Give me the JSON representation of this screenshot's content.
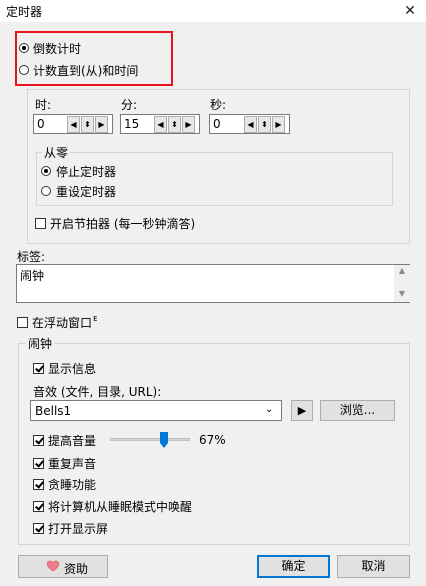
{
  "window": {
    "title": "定时器",
    "close_glyph": "✕"
  },
  "mode": {
    "countdown_label": "倒数计时",
    "countup_label": "计数直到(从)和时间",
    "selected": "countdown"
  },
  "time": {
    "hours_label": "时:",
    "minutes_label": "分:",
    "seconds_label": "秒:",
    "hours_value": "0",
    "minutes_value": "15",
    "seconds_value": "0"
  },
  "from_zero": {
    "group_label": "从零",
    "stop_label": "停止定时器",
    "reset_label": "重设定时器",
    "selected": "stop"
  },
  "metronome": {
    "label": "开启节拍器 (每一秒钟滴答)",
    "checked": false
  },
  "tag": {
    "label": "标签:",
    "value": "闹钟"
  },
  "float_window": {
    "label": "在浮动窗口",
    "cursor": "ᴇ",
    "checked": false
  },
  "alarm": {
    "group_label": "闹钟",
    "show_message_label": "显示信息",
    "sound_label": "音效 (文件, 目录, URL):",
    "sound_value": "Bells1",
    "browse_label": "浏览...",
    "play_glyph": "▶",
    "raise_volume_label": "提高音量",
    "volume_percent": "67%",
    "volume_value": 0.67,
    "repeat_sound_label": "重复声音",
    "snooze_label": "贪睡功能",
    "wake_label": "将计算机从睡眠模式中唤醒",
    "turn_on_display_label": "打开显示屏",
    "checked": {
      "show_message": true,
      "raise_volume": true,
      "repeat_sound": true,
      "snooze": true,
      "wake": true,
      "display": true
    }
  },
  "footer": {
    "donate_label": "资助",
    "ok_label": "确定",
    "cancel_label": "取消"
  },
  "colors": {
    "highlight_box": "#e8141b",
    "slider_thumb": "#0078d7",
    "default_button_border": "#0078d7",
    "heart": "#f07a8a"
  },
  "icons": {
    "heart": "heart-icon",
    "play": "play-icon",
    "dropdown": "chevron-down-icon"
  }
}
